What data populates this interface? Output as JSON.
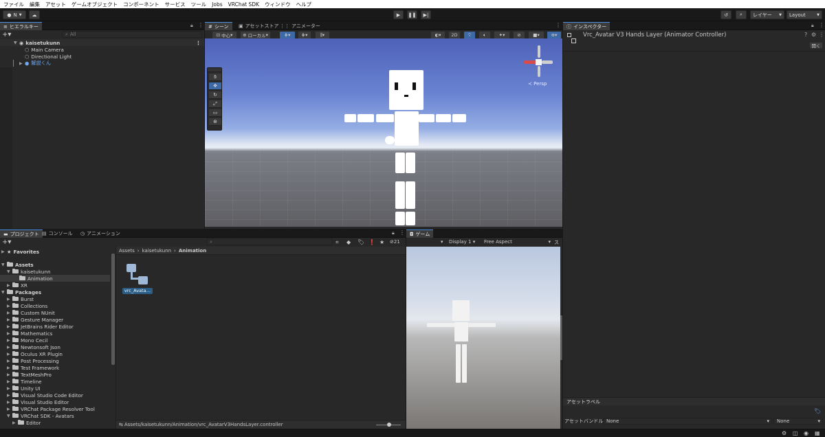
{
  "menu": [
    "ファイル",
    "編集",
    "アセット",
    "ゲームオブジェクト",
    "コンポーネント",
    "サービス",
    "ツール",
    "Jobs",
    "VRChat SDK",
    "ウィンドウ",
    "ヘルプ"
  ],
  "toolbar": {
    "account": "N",
    "layers": "レイヤー",
    "layout": "Layout"
  },
  "hierarchy": {
    "tab": "ヒエラルキー",
    "search_placeholder": "All",
    "scene": "kaisetukunn",
    "items": [
      "Main Camera",
      "Directional Light",
      "解説くん"
    ]
  },
  "scene_panel": {
    "tabs": [
      "シーン",
      "アセットストア",
      "アニメーター"
    ],
    "pivot": "中心",
    "space": "ローカル",
    "mode2d": "2D",
    "persp": "Persp"
  },
  "inspector": {
    "tab": "インスペクター",
    "title": "Vrc_Avatar V3 Hands Layer (Animator Controller)",
    "open_button": "開く",
    "asset_label": "アセットラベル",
    "asset_bundle": "アセットバンドル",
    "bundle_value": "None",
    "variant_value": "None"
  },
  "project": {
    "tabs": [
      "プロジェクト",
      "コンソール",
      "アニメーション"
    ],
    "count": "21",
    "favorites": "Favorites",
    "assets": "Assets",
    "kaisetukunn": "kaisetukunn",
    "animation": "Animation",
    "xr": "XR",
    "packages": "Packages",
    "package_items": [
      "Burst",
      "Collections",
      "Custom NUnit",
      "Gesture Manager",
      "JetBrains Rider Editor",
      "Mathematics",
      "Mono Cecil",
      "Newtonsoft Json",
      "Oculus XR Plugin",
      "Post Processing",
      "Test Framework",
      "TextMeshPro",
      "Timeline",
      "Unity UI",
      "Visual Studio Code Editor",
      "Visual Studio Editor",
      "VRChat Package Resolver Tool",
      "VRChat SDK - Avatars"
    ],
    "editor": "Editor",
    "breadcrumb": [
      "Assets",
      "kaisetukunn",
      "Animation"
    ],
    "asset_name": "vrc_Avata…",
    "path": "Assets/kaisetukunn/Animation/vrc_AvatarV3HandsLayer.controller"
  },
  "game": {
    "tab": "ゲーム",
    "display": "Display 1",
    "aspect": "Free Aspect",
    "scale": "ス"
  }
}
